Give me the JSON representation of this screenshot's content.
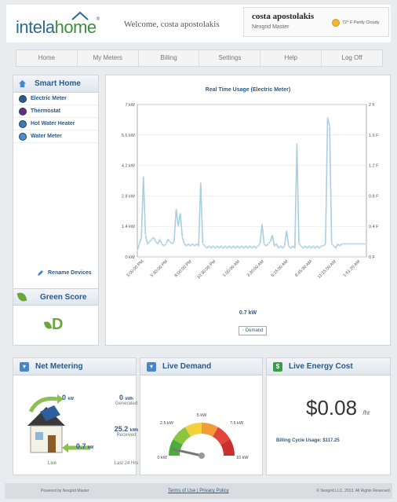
{
  "header": {
    "logo_text_a": "intela",
    "logo_text_b": "home",
    "logo_mark": "®",
    "welcome": "Welcome, costa apostolakis",
    "user_name": "costa apostolakis",
    "user_role": "Nexgrid Master",
    "weather": "72° F Partly Cloudy"
  },
  "nav": [
    "Home",
    "My Meters",
    "Billing",
    "Settings",
    "Help",
    "Log Off"
  ],
  "sidebar": {
    "title": "Smart Home",
    "items": [
      "Electric Meter",
      "Thermostat",
      "Hot Water Heater",
      "Water Meter"
    ],
    "rename": "Rename Devices",
    "green_title": "Green Score",
    "green_score": "D"
  },
  "chart_data": {
    "type": "line",
    "title": "Real Time Usage (Electric Meter)",
    "x_tick_labels": [
      "3:00:00 PM",
      "5:30:00 PM",
      "8:00:00 PM",
      "10:30:00 PM",
      "1:00:00 AM",
      "3:30:00 AM",
      "6:15:00 AM",
      "8:45:00 AM",
      "11:15:00 AM",
      "1:51:20 AM"
    ],
    "y_left_ticks": [
      "0 kW",
      "1.4 kW",
      "2.8 kW",
      "4.2 kW",
      "5.6 kW",
      "7 kW"
    ],
    "y_right_ticks": [
      "0 F",
      "0.4 F",
      "0.8 F",
      "1.2 F",
      "1.6 F",
      "2 F"
    ],
    "ylim": [
      0,
      7
    ],
    "series": [
      {
        "name": "Demand",
        "values": [
          0.3,
          0.6,
          0.9,
          3.7,
          1.0,
          0.6,
          0.7,
          0.8,
          0.9,
          0.7,
          0.6,
          0.8,
          0.6,
          0.5,
          0.6,
          0.8,
          0.7,
          0.6,
          0.7,
          2.2,
          1.4,
          2.0,
          0.9,
          0.6,
          0.5,
          0.6,
          0.5,
          0.6,
          0.5,
          0.6,
          0.5,
          3.4,
          0.6,
          0.5,
          0.4,
          0.5,
          0.4,
          0.5,
          0.4,
          0.5,
          0.4,
          0.5,
          0.4,
          0.5,
          0.4,
          0.5,
          0.4,
          0.5,
          0.4,
          0.5,
          0.4,
          0.5,
          0.4,
          0.5,
          0.4,
          0.5,
          0.4,
          0.5,
          0.4,
          0.5,
          0.6,
          1.5,
          0.6,
          0.5,
          0.6,
          0.7,
          1.0,
          0.5,
          0.6,
          0.4,
          0.5,
          0.4,
          0.5,
          1.2,
          0.5,
          0.4,
          0.5,
          0.4,
          5.2,
          0.6,
          0.5,
          0.4,
          0.5,
          0.4,
          0.5,
          0.4,
          0.5,
          0.4,
          0.5,
          0.4,
          0.5,
          0.5,
          0.6,
          6.4,
          6.0,
          0.6,
          0.5,
          0.4,
          0.6,
          0.5,
          0.6,
          0.6,
          0.6,
          0.6,
          0.6,
          0.6,
          0.6,
          0.6,
          0.6,
          0.6,
          0.6,
          0.6,
          0.6
        ]
      }
    ],
    "demand_label": "0.7 kW",
    "legend": "Demand"
  },
  "net_metering": {
    "title": "Net Metering",
    "top_kw": "0",
    "top_unit": "kW",
    "bottom_kw": "0.7",
    "bottom_unit": "kW",
    "live": "Live",
    "generated_val": "0",
    "generated_unit": "kWh",
    "generated_label": "Generated",
    "received_val": "25.2",
    "received_unit": "kWh",
    "received_label": "Received",
    "period": "Last 24 Hrs"
  },
  "live_demand": {
    "title": "Live Demand",
    "gauge_labels": [
      "0 kW",
      "2.5 kW",
      "5 kW",
      "7.5 kW",
      "10 kW"
    ],
    "value": 0.7,
    "max": 10
  },
  "live_cost": {
    "title": "Live Energy Cost",
    "value": "$0.08",
    "unit": "/hr",
    "billing": "Billing Cycle Usage: $117.25"
  },
  "footer": {
    "powered": "Powered by Nexgrid Master",
    "terms": "Terms of Use",
    "sep": "|",
    "privacy": "Privacy Policy",
    "copyright": "© Nexgrid LLC. 2013. All Rights Reserved."
  },
  "colors": {
    "accent": "#2b5a86",
    "green": "#6aa73a",
    "line": "#a9cfe0"
  }
}
